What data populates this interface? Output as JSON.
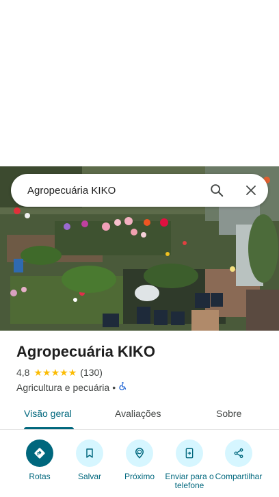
{
  "search": {
    "query": "Agropecuária KIKO",
    "search_icon": "search-icon",
    "close_icon": "close-icon"
  },
  "place": {
    "name": "Agropecuária KIKO",
    "rating": "4,8",
    "stars": 5,
    "review_count": "(130)",
    "category": "Agricultura e pecuária",
    "separator": "•",
    "accessibility_icon": "wheelchair-icon"
  },
  "tabs": [
    {
      "label": "Visão geral",
      "active": true
    },
    {
      "label": "Avaliações",
      "active": false
    },
    {
      "label": "Sobre",
      "active": false
    }
  ],
  "actions": [
    {
      "label": "Rotas",
      "icon": "directions-icon"
    },
    {
      "label": "Salvar",
      "icon": "bookmark-icon"
    },
    {
      "label": "Próximo",
      "icon": "nearby-icon"
    },
    {
      "label": "Enviar para o telefone",
      "icon": "send-to-phone-icon"
    },
    {
      "label": "Compartilhar",
      "icon": "share-icon"
    }
  ],
  "colors": {
    "accent": "#00677d",
    "action_bg": "#d6f6ff",
    "star": "#fbbc04"
  }
}
